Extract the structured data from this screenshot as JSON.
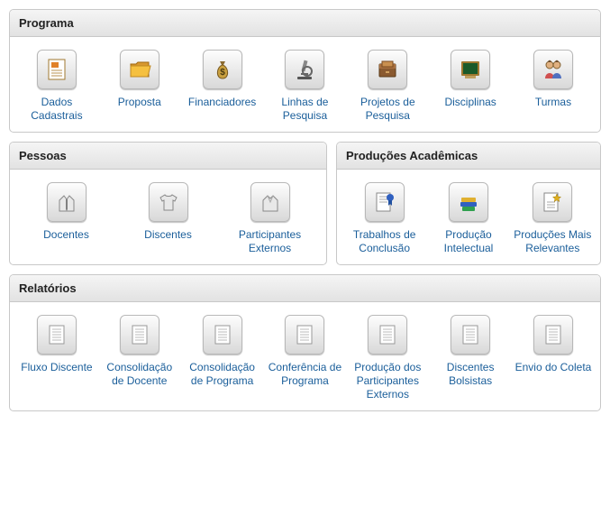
{
  "panels": {
    "programa": {
      "title": "Programa",
      "items": [
        {
          "label": "Dados Cadastrais",
          "icon": "document"
        },
        {
          "label": "Proposta",
          "icon": "folder"
        },
        {
          "label": "Financiadores",
          "icon": "moneybag"
        },
        {
          "label": "Linhas de Pesquisa",
          "icon": "microscope"
        },
        {
          "label": "Projetos de Pesquisa",
          "icon": "drawer"
        },
        {
          "label": "Disciplinas",
          "icon": "chalkboard"
        },
        {
          "label": "Turmas",
          "icon": "people"
        }
      ]
    },
    "pessoas": {
      "title": "Pessoas",
      "items": [
        {
          "label": "Docentes",
          "icon": "shirt-tie"
        },
        {
          "label": "Discentes",
          "icon": "tshirt"
        },
        {
          "label": "Participantes Externos",
          "icon": "shirt-plain"
        }
      ]
    },
    "producoes": {
      "title": "Produções Acadêmicas",
      "items": [
        {
          "label": "Trabalhos de Conclusão",
          "icon": "certificate"
        },
        {
          "label": "Produção Intelectual",
          "icon": "books"
        },
        {
          "label": "Produções Mais Relevantes",
          "icon": "star-badge"
        }
      ]
    },
    "relatorios": {
      "title": "Relatórios",
      "items": [
        {
          "label": "Fluxo Discente",
          "icon": "report"
        },
        {
          "label": "Consolidação de Docente",
          "icon": "report"
        },
        {
          "label": "Consolidação de Programa",
          "icon": "report"
        },
        {
          "label": "Conferência de Programa",
          "icon": "report"
        },
        {
          "label": "Produção dos Participantes Externos",
          "icon": "report"
        },
        {
          "label": "Discentes Bolsistas",
          "icon": "report"
        },
        {
          "label": "Envio do Coleta",
          "icon": "report"
        }
      ]
    }
  }
}
